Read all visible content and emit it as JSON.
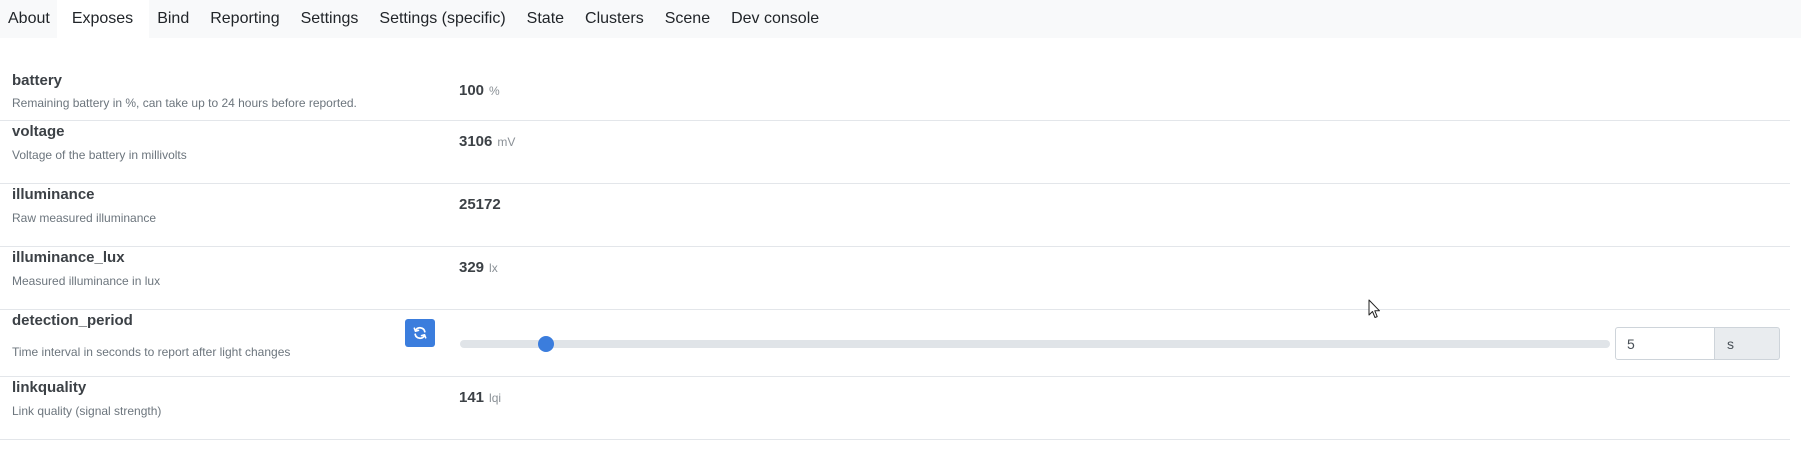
{
  "tabs": [
    {
      "label": "About",
      "active": false
    },
    {
      "label": "Exposes",
      "active": true
    },
    {
      "label": "Bind",
      "active": false
    },
    {
      "label": "Reporting",
      "active": false
    },
    {
      "label": "Settings",
      "active": false
    },
    {
      "label": "Settings (specific)",
      "active": false
    },
    {
      "label": "State",
      "active": false
    },
    {
      "label": "Clusters",
      "active": false
    },
    {
      "label": "Scene",
      "active": false
    },
    {
      "label": "Dev console",
      "active": false
    }
  ],
  "exposes": {
    "battery": {
      "name": "battery",
      "description": "Remaining battery in %, can take up to 24 hours before reported.",
      "value": "100",
      "unit": "%"
    },
    "voltage": {
      "name": "voltage",
      "description": "Voltage of the battery in millivolts",
      "value": "3106",
      "unit": "mV"
    },
    "illuminance": {
      "name": "illuminance",
      "description": "Raw measured illuminance",
      "value": "25172",
      "unit": ""
    },
    "illuminance_lux": {
      "name": "illuminance_lux",
      "description": "Measured illuminance in lux",
      "value": "329",
      "unit": "lx"
    },
    "detection_period": {
      "name": "detection_period",
      "description": "Time interval in seconds to report after light changes",
      "value": "5",
      "unit": "s",
      "slider_fraction": 0.075
    },
    "linkquality": {
      "name": "linkquality",
      "description": "Link quality (signal strength)",
      "value": "141",
      "unit": "lqi"
    }
  },
  "icons": {
    "refresh": "refresh-icon",
    "cursor": "mouse-cursor-icon"
  },
  "colors": {
    "accent": "#3b7ddd",
    "tabbar_bg": "#f8f9fa",
    "divider": "#e3e6ea"
  }
}
